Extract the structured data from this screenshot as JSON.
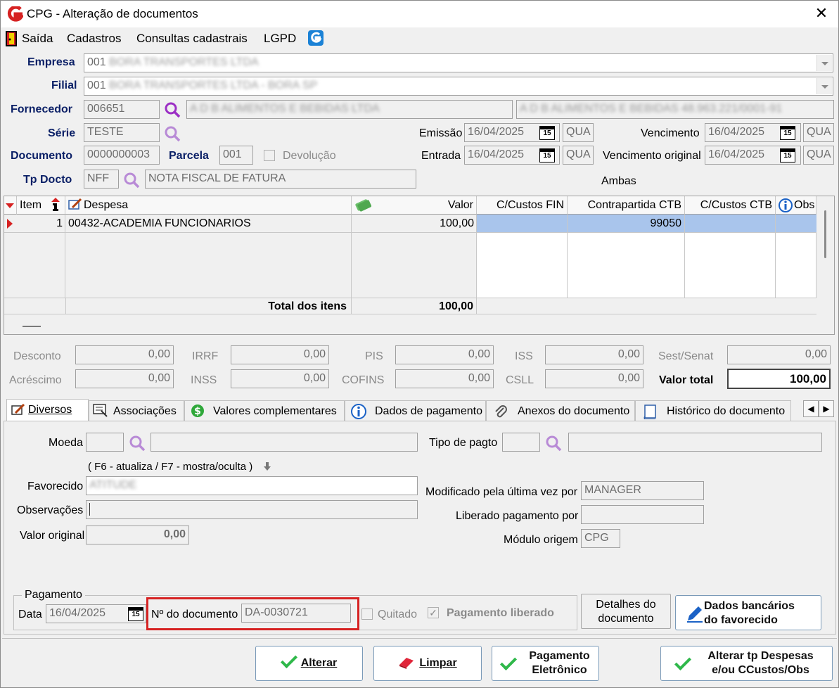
{
  "window": {
    "title": "CPG - Alteração de documentos"
  },
  "menu": {
    "items": [
      "Saída",
      "Cadastros",
      "Consultas cadastrais",
      "LGPD"
    ]
  },
  "header": {
    "empresa_label": "Empresa",
    "empresa_code": "001",
    "empresa_name": "BORA TRANSPORTES LTDA",
    "filial_label": "Filial",
    "filial_code": "001",
    "filial_name": "BORA TRANSPORTES LTDA - BORA SP",
    "fornecedor_label": "Fornecedor",
    "fornecedor_code": "006651",
    "fornecedor_name": "A D B ALIMENTOS E BEBIDAS LTDA",
    "fornecedor_extra": "A D B ALIMENTOS E BEBIDAS  48.963.221/0001-91",
    "serie_label": "Série",
    "serie_value": "TESTE",
    "documento_label": "Documento",
    "documento_value": "0000000003",
    "parcela_label": "Parcela",
    "parcela_value": "001",
    "devolucao_label": "Devolução",
    "tpdocto_label": "Tp Docto",
    "tpdocto_code": "NFF",
    "tpdocto_name": "NOTA FISCAL DE FATURA",
    "emissao_label": "Emissão",
    "emissao_value": "16/04/2025",
    "emissao_day": "QUA",
    "entrada_label": "Entrada",
    "entrada_value": "16/04/2025",
    "entrada_day": "QUA",
    "vencimento_label": "Vencimento",
    "vencimento_value": "16/04/2025",
    "vencimento_day": "QUA",
    "vencorig_label": "Vencimento original",
    "vencorig_value": "16/04/2025",
    "vencorig_day": "QUA",
    "ambas": "Ambas",
    "calendar_day": "15"
  },
  "grid": {
    "columns": [
      "Item",
      "Despesa",
      "Valor",
      "C/Custos FIN",
      "Contrapartida CTB",
      "C/Custos CTB",
      "Obs"
    ],
    "rows": [
      {
        "item": "1",
        "despesa": "00432-ACADEMIA FUNCIONARIOS",
        "valor": "100,00",
        "contrapartida": "99050"
      }
    ],
    "total_label": "Total dos itens",
    "total_value": "100,00"
  },
  "totals": {
    "desconto_label": "Desconto",
    "desconto": "0,00",
    "acrescimo_label": "Acréscimo",
    "acrescimo": "0,00",
    "irrf_label": "IRRF",
    "irrf": "0,00",
    "inss_label": "INSS",
    "inss": "0,00",
    "pis_label": "PIS",
    "pis": "0,00",
    "cofins_label": "COFINS",
    "cofins": "0,00",
    "iss_label": "ISS",
    "iss": "0,00",
    "csll_label": "CSLL",
    "csll": "0,00",
    "sest_label": "Sest/Senat",
    "sest": "0,00",
    "valortotal_label": "Valor total",
    "valortotal": "100,00"
  },
  "tabs": [
    "Diversos",
    "Associações",
    "Valores complementares",
    "Dados de pagamento",
    "Anexos do documento",
    "Histórico do documento"
  ],
  "diversos": {
    "moeda_label": "Moeda",
    "tipopagto_label": "Tipo de pagto",
    "f6_hint": "( F6 - atualiza / F7 - mostra/oculta )",
    "favorecido_label": "Favorecido",
    "favorecido_value": "ATITUDE",
    "observacoes_label": "Observações",
    "valororiginal_label": "Valor original",
    "valororiginal_value": "0,00",
    "modificado_label": "Modificado pela última vez por",
    "modificado_value": "MANAGER",
    "liberado_label": "Liberado pagamento por",
    "modulo_label": "Módulo origem",
    "modulo_value": "CPG",
    "pagamento_group": "Pagamento",
    "data_label": "Data",
    "data_value": "16/04/2025",
    "ndoc_label": "Nº do documento",
    "ndoc_value": "DA-0030721",
    "quitado_label": "Quitado",
    "pagliberado_label": "Pagamento liberado",
    "detalhes_line1": "Detalhes do",
    "detalhes_line2": "documento",
    "dadosbanc_line1": "Dados bancários",
    "dadosbanc_line2": "do favorecido"
  },
  "footer": {
    "alterar": "Alterar",
    "limpar": "Limpar",
    "pagel_line1": "Pagamento",
    "pagel_line2": "Eletrônico",
    "altertp_line1": "Alterar tp Despesas",
    "altertp_line2": "e/ou CCustos/Obs"
  },
  "colors": {
    "label_blue": "#0a1f66",
    "selection": "#a9c5ec",
    "highlight_red": "#d62222",
    "check_green": "#2fb84a"
  }
}
